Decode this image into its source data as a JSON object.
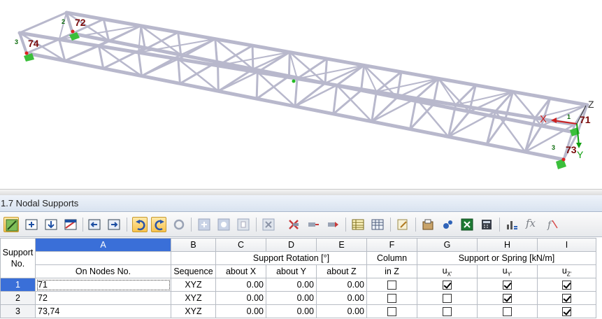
{
  "viewport": {
    "node_labels": [
      {
        "id": "n72",
        "num": "2",
        "label": "72"
      },
      {
        "id": "n74",
        "num": "3",
        "label": "74"
      },
      {
        "id": "n71",
        "num": "1",
        "label": "71"
      },
      {
        "id": "n73",
        "num": "3",
        "label": "73"
      }
    ],
    "axes": {
      "x": "X",
      "y": "Y",
      "z": "Z"
    },
    "colors": {
      "truss": "#b8b8cc",
      "support": "#3bbf3b",
      "label": "#7a0a0a",
      "axis_x": "#cc2020",
      "axis_y": "#10a010"
    }
  },
  "panel": {
    "title": "1.7 Nodal Supports"
  },
  "toolbar": {
    "fx_label": "fx",
    "buttons": [
      "select-table-icon",
      "insert-row-icon",
      "delete-row-icon",
      "import-icon",
      "prev-table-icon",
      "next-table-icon",
      "undo-icon",
      "redo-icon",
      "refresh-icon",
      "zoom-in-icon",
      "zoom-out-icon",
      "zoom-fit-icon",
      "delete-icon",
      "cut-icon",
      "paste-icon",
      "table-icon",
      "columns-icon",
      "edit-icon",
      "graphics-icon",
      "settings-icon",
      "excel-icon",
      "calculator-icon",
      "chart-icon",
      "formula-icon",
      "formula-off-icon"
    ]
  },
  "table": {
    "letters": [
      "A",
      "B",
      "C",
      "D",
      "E",
      "F",
      "G",
      "H",
      "I"
    ],
    "header1": {
      "support_no": "Support",
      "rotation": "Support Rotation [°]",
      "column": "Column",
      "spring": "Support or Spring [kN/m]"
    },
    "header2": {
      "support_no": "No.",
      "nodes": "On Nodes No.",
      "sequence": "Sequence",
      "about_x": "about X",
      "about_y": "about Y",
      "about_z": "about Z",
      "in_z": "in Z",
      "ux": "u",
      "ux_sub": "X'",
      "uy": "u",
      "uy_sub": "Y'",
      "uz": "u",
      "uz_sub": "Z'"
    },
    "rows": [
      {
        "no": "1",
        "nodes": "71",
        "sequence": "XYZ",
        "about_x": "0.00",
        "about_y": "0.00",
        "about_z": "0.00",
        "column": false,
        "ux": true,
        "uy": true,
        "uz": true
      },
      {
        "no": "2",
        "nodes": "72",
        "sequence": "XYZ",
        "about_x": "0.00",
        "about_y": "0.00",
        "about_z": "0.00",
        "column": false,
        "ux": false,
        "uy": true,
        "uz": true
      },
      {
        "no": "3",
        "nodes": "73,74",
        "sequence": "XYZ",
        "about_x": "0.00",
        "about_y": "0.00",
        "about_z": "0.00",
        "column": false,
        "ux": false,
        "uy": false,
        "uz": true
      }
    ]
  }
}
